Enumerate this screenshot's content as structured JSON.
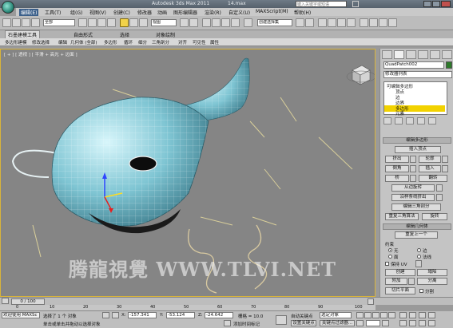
{
  "window": {
    "title": "Autodesk 3ds Max  2011",
    "file": "14.max",
    "search_placeholder": "键入关键字或短语"
  },
  "menubar": {
    "items": [
      {
        "label": "编辑(E)"
      },
      {
        "label": "工具(T)"
      },
      {
        "label": "组(G)"
      },
      {
        "label": "视图(V)"
      },
      {
        "label": "创建(C)"
      },
      {
        "label": "修改器"
      },
      {
        "label": "动画"
      },
      {
        "label": "图形编辑器"
      },
      {
        "label": "渲染(R)"
      },
      {
        "label": "自定义(U)"
      },
      {
        "label": "MAXScript(M)"
      },
      {
        "label": "帮助(H)"
      }
    ]
  },
  "toolbar": {
    "selection_filter": "全部",
    "reference_coord": "视图",
    "named_selection": "创建选择集"
  },
  "ribbon": {
    "tabs": [
      {
        "label": "石墨建模工具"
      },
      {
        "label": "自由形式"
      },
      {
        "label": "选择"
      },
      {
        "label": "对象绘制"
      }
    ],
    "subitems": [
      "多边形建模",
      "修改选择",
      "编辑",
      "几何体 (全部)",
      "多边形",
      "循环",
      "细分",
      "三角剖分",
      "对齐",
      "可见性",
      "属性"
    ]
  },
  "viewport": {
    "label": "[ + ] [ 透视 ] [ 平滑 + 高光 + 边面 ]"
  },
  "command_panel": {
    "object_name": "QuadPatch002",
    "modifier_list": "修改器列表",
    "stack": [
      {
        "label": "可编辑多边形"
      },
      {
        "label": "顶点"
      },
      {
        "label": "边"
      },
      {
        "label": "边界"
      },
      {
        "label": "多边形"
      },
      {
        "label": "元素"
      }
    ],
    "edit_polygons": {
      "title": "编辑多边形",
      "insert_vertex": "插入顶点",
      "extrude": "挤出",
      "outline": "轮廓",
      "bevel": "倒角",
      "inset": "插入",
      "bridge": "桥",
      "flip": "翻转",
      "hinge": "从边旋转",
      "extrude_spline": "沿样条线挤出",
      "edit_triangulation": "编辑三角剖分",
      "retriangulate": "重复三角算法",
      "turn": "旋转"
    },
    "edit_geometry": {
      "title": "编辑几何体",
      "repeat_last": "重复上一个",
      "constraints": "约束",
      "none": "无",
      "edge": "边",
      "face": "面",
      "normal": "法线",
      "preserve_uvs": "保持 UV",
      "create": "创建",
      "collapse": "塌陷",
      "attach": "附加",
      "detach": "分离",
      "slice_plane": "切片平面",
      "split": "分割"
    }
  },
  "timeline": {
    "frame_display": "0 / 100",
    "ticks": [
      "0",
      "10",
      "20",
      "30",
      "40",
      "50",
      "60",
      "70",
      "80",
      "90",
      "100"
    ]
  },
  "statusbar": {
    "maxscript_label": "欢迎使用 MAXSc",
    "selection_status": "选择了 1 个 对象",
    "prompt": "单击或单击并拖动以选择对象",
    "x_label": "X:",
    "x_value": "-157.341",
    "y_label": "Y:",
    "y_value": "-53.124",
    "z_label": "Z:",
    "z_value": "-24.642",
    "grid": "栅格 = 10.0",
    "add_time_tag": "添加时间标记",
    "auto_key": "自动关键点",
    "auto_key_filter": "选定对象",
    "set_key": "设置关键点",
    "key_filters": "关键点过滤器..."
  },
  "watermark": "腾龍視覺  WWW.TLVI.NET"
}
